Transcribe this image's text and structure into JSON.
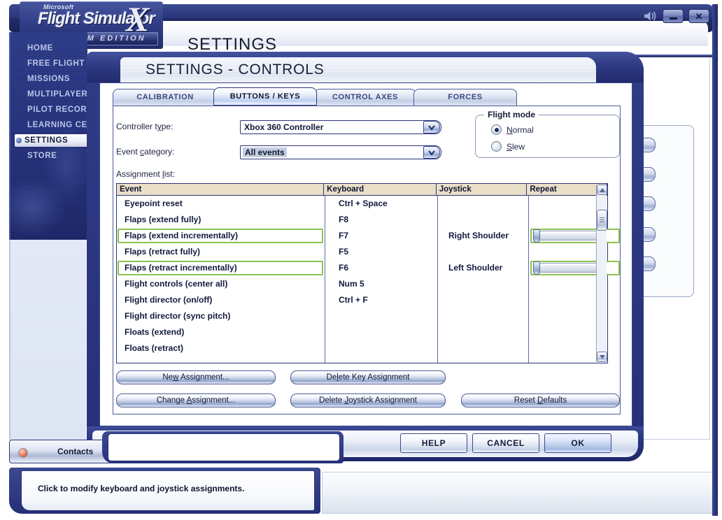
{
  "app": {
    "logo": {
      "microsoft": "Microsoft",
      "product": "Flight Simulator",
      "x": "X",
      "edition": "STEAM EDITION"
    },
    "header_title": "SETTINGS",
    "window_controls": {
      "sound": "speaker-icon",
      "minimize": "–",
      "close": "✕"
    }
  },
  "sidebar": {
    "items": [
      {
        "label": "HOME",
        "active": false
      },
      {
        "label": "FREE FLIGHT",
        "active": false
      },
      {
        "label": "MISSIONS",
        "active": false
      },
      {
        "label": "MULTIPLAYER",
        "active": false
      },
      {
        "label": "PILOT RECORDS",
        "active": false
      },
      {
        "label": "LEARNING CENTER",
        "active": false
      },
      {
        "label": "SETTINGS",
        "active": true
      },
      {
        "label": "STORE",
        "active": false
      }
    ]
  },
  "dialog": {
    "title": "SETTINGS - CONTROLS",
    "tabs": [
      {
        "label": "CALIBRATION",
        "active": false
      },
      {
        "label": "BUTTONS / KEYS",
        "active": true
      },
      {
        "label": "CONTROL AXES",
        "active": false
      },
      {
        "label": "FORCES",
        "active": false
      }
    ],
    "fields": {
      "controller_type_label_pre": "Controller t",
      "controller_type_label_u": "y",
      "controller_type_label_post": "pe:",
      "controller_type_value": "Xbox 360 Controller",
      "event_category_label_pre": "Event ",
      "event_category_label_u": "c",
      "event_category_label_post": "ategory:",
      "event_category_value": "All events",
      "assignment_list_label_pre": "Assignment ",
      "assignment_list_label_u": "l",
      "assignment_list_label_post": "ist:"
    },
    "flight_mode": {
      "legend": "Flight mode",
      "options": [
        {
          "label_u": "N",
          "label_post": "ormal",
          "selected": true
        },
        {
          "label_u": "S",
          "label_post": "lew",
          "selected": false
        }
      ]
    },
    "table": {
      "columns": [
        "Event",
        "Keyboard",
        "Joystick",
        "Repeat"
      ],
      "rows": [
        {
          "event": "Eyepoint reset",
          "keyboard": "Ctrl + Space",
          "joystick": "",
          "repeat": false,
          "highlight": false
        },
        {
          "event": "Flaps (extend fully)",
          "keyboard": "F8",
          "joystick": "",
          "repeat": false,
          "highlight": false
        },
        {
          "event": "Flaps (extend incrementally)",
          "keyboard": "F7",
          "joystick": "Right Shoulder",
          "repeat": true,
          "highlight": true
        },
        {
          "event": "Flaps (retract fully)",
          "keyboard": "F5",
          "joystick": "",
          "repeat": false,
          "highlight": false
        },
        {
          "event": "Flaps (retract incrementally)",
          "keyboard": "F6",
          "joystick": "Left Shoulder",
          "repeat": true,
          "highlight": true
        },
        {
          "event": "Flight controls (center all)",
          "keyboard": "Num 5",
          "joystick": "",
          "repeat": false,
          "highlight": false
        },
        {
          "event": "Flight director (on/off)",
          "keyboard": "Ctrl + F",
          "joystick": "",
          "repeat": false,
          "highlight": false
        },
        {
          "event": "Flight director (sync pitch)",
          "keyboard": "",
          "joystick": "",
          "repeat": false,
          "highlight": false
        },
        {
          "event": "Floats (extend)",
          "keyboard": "",
          "joystick": "",
          "repeat": false,
          "highlight": false
        },
        {
          "event": "Floats (retract)",
          "keyboard": "",
          "joystick": "",
          "repeat": false,
          "highlight": false
        }
      ]
    },
    "action_buttons": [
      {
        "pre": "Ne",
        "u": "w",
        "post": " Assignment..."
      },
      {
        "pre": "De",
        "u": "l",
        "post": "ete Key Assignment"
      },
      {
        "pre": "Change ",
        "u": "A",
        "post": "ssignment..."
      },
      {
        "pre": "Delete ",
        "u": "J",
        "post": "oystick Assignment"
      },
      {
        "pre": "Reset ",
        "u": "D",
        "post": "efaults"
      }
    ],
    "footer_buttons": [
      {
        "label": "HELP",
        "primary": false
      },
      {
        "label": "CANCEL",
        "primary": false
      },
      {
        "label": "OK",
        "primary": true
      }
    ]
  },
  "bottom": {
    "contacts_label": "Contacts",
    "status_text": "Click to modify keyboard and joystick assignments."
  },
  "colors": {
    "accent_blue": "#2a3379",
    "highlight_green": "#8cc152",
    "table_header": "#e9dfc8",
    "sidebar_blue": "#24307a"
  }
}
